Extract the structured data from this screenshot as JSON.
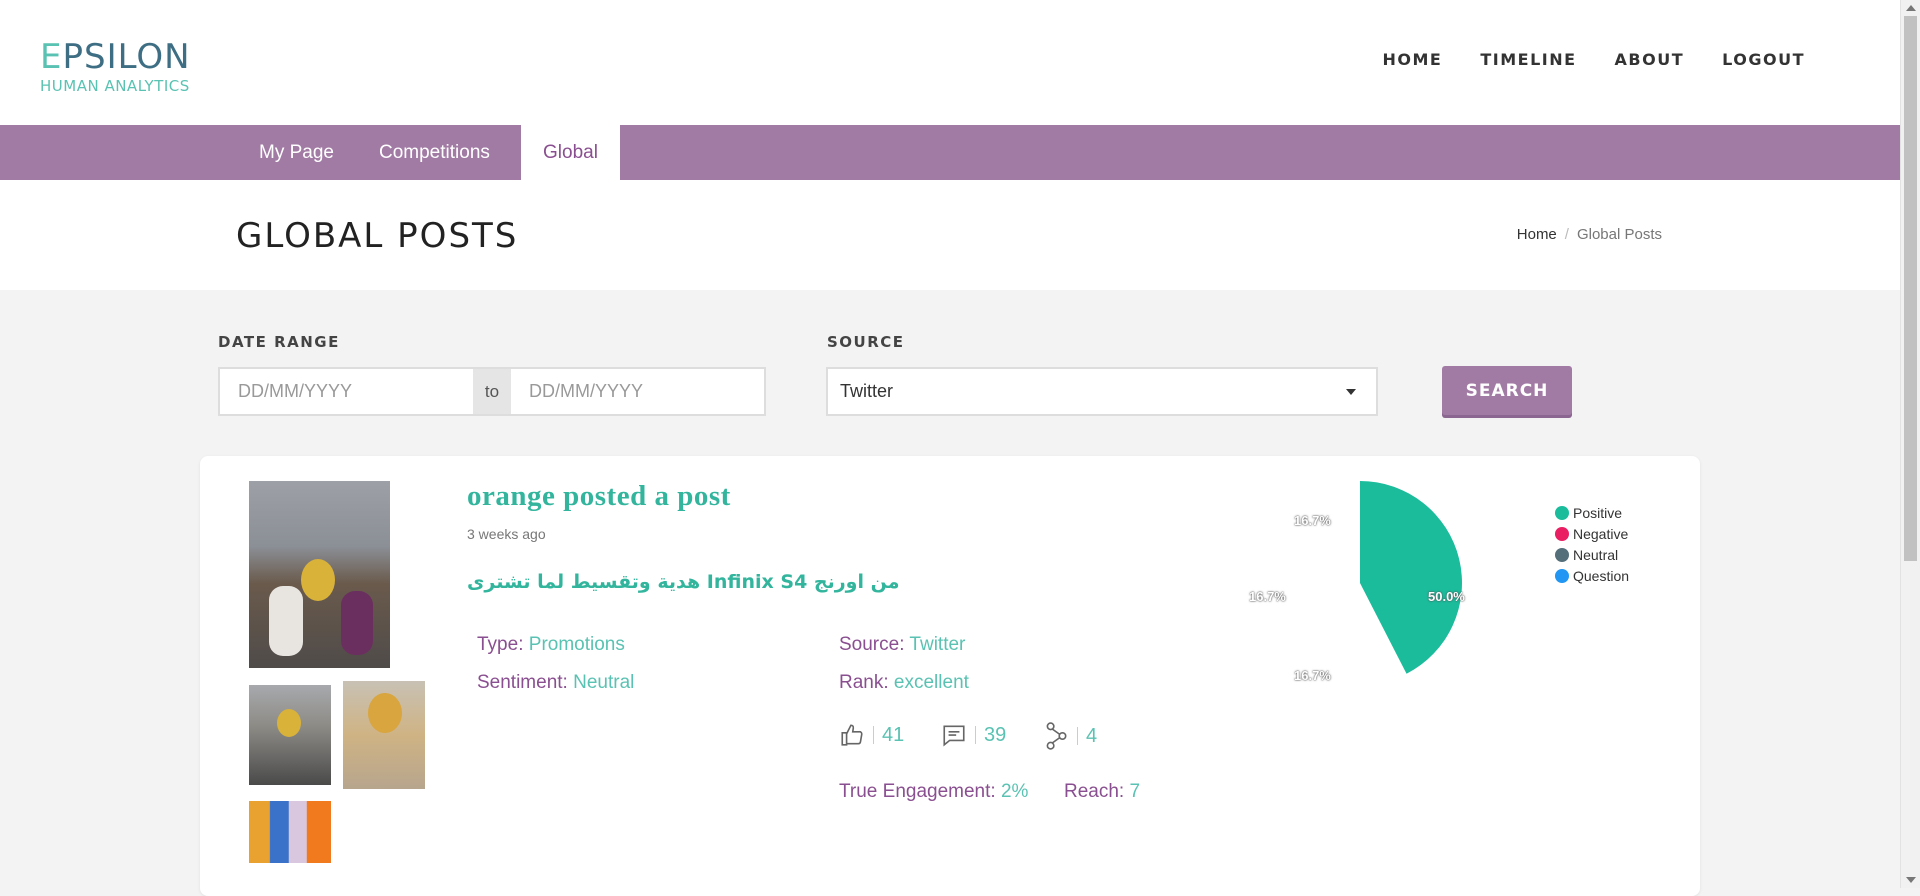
{
  "brand": {
    "logo_main": "EPSILON",
    "logo_sub": "HUMAN ANALYTICS",
    "teal": "#5ac2b2",
    "purple": "#a27ba5",
    "purple_text": "#8a4f90"
  },
  "nav": {
    "home": "HOME",
    "timeline": "TIMELINE",
    "about": "ABOUT",
    "logout": "LOGOUT"
  },
  "tabs": [
    {
      "label": "My Page",
      "active": false
    },
    {
      "label": "Competitions",
      "active": false
    },
    {
      "label": "Global",
      "active": true
    }
  ],
  "page": {
    "title": "GLOBAL POSTS"
  },
  "breadcrumb": {
    "home": "Home",
    "separator": "/",
    "current": "Global Posts"
  },
  "filters": {
    "date_range_label": "DATE RANGE",
    "from_placeholder": "DD/MM/YYYY",
    "to_text": "to",
    "to_placeholder": "DD/MM/YYYY",
    "source_label": "SOURCE",
    "source_value": "Twitter",
    "search_label": "SEARCH"
  },
  "post": {
    "title": "orange posted a post",
    "time": "3 weeks ago",
    "text": "من اورنج Infinix S4 هدية وتقسيط لما تشترى",
    "type_label": "Type:",
    "type_value": "Promotions",
    "sentiment_label": "Sentiment:",
    "sentiment_value": "Neutral",
    "source_label": "Source:",
    "source_value": "Twitter",
    "rank_label": "Rank:",
    "rank_value": "excellent",
    "likes": "41",
    "comments": "39",
    "shares": "4",
    "engagement_label": "True Engagement:",
    "engagement_value": "2%",
    "reach_label": "Reach:",
    "reach_value": "7",
    "icons": [
      "thumbs-up-icon",
      "comment-icon",
      "share-icon"
    ]
  },
  "chart_data": {
    "type": "pie",
    "slices": [
      {
        "name": "Positive",
        "value": 50.0,
        "label": "50.0%",
        "color": "#1abc9c"
      },
      {
        "name": "Negative",
        "value": 16.7,
        "label": "16.7%",
        "color": "#e91e63"
      },
      {
        "name": "Neutral",
        "value": 16.7,
        "label": "16.7%",
        "color": "#546e7a"
      },
      {
        "name": "Question",
        "value": 16.7,
        "label": "16.7%",
        "color": "#2196f3"
      }
    ],
    "visible_slices": [
      "Positive"
    ],
    "legend_position": "right"
  }
}
